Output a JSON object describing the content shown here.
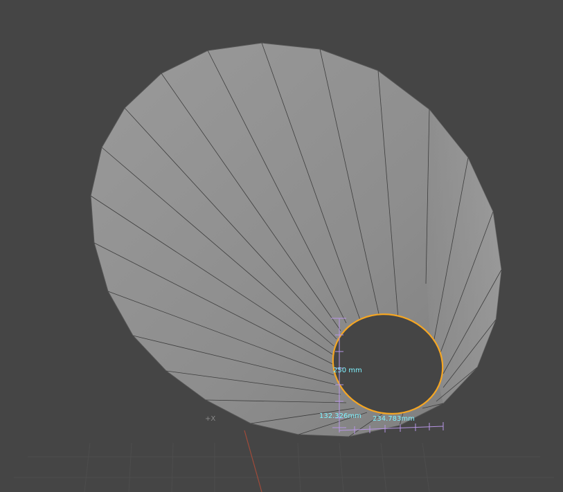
{
  "viewport": {
    "axis_label": "+X",
    "colors": {
      "background": "#454545",
      "surface": "#8f8f8f",
      "edge": "#3a3a3a",
      "selection": "#f5a623",
      "dimension_text": "#7ff3ff",
      "dimension_lines": "#b896e6",
      "x_axis": "#a04b3a"
    }
  },
  "dimensions": {
    "diameter": "250 mm",
    "offset_y": "132.326mm",
    "offset_x": "234.783mm"
  }
}
